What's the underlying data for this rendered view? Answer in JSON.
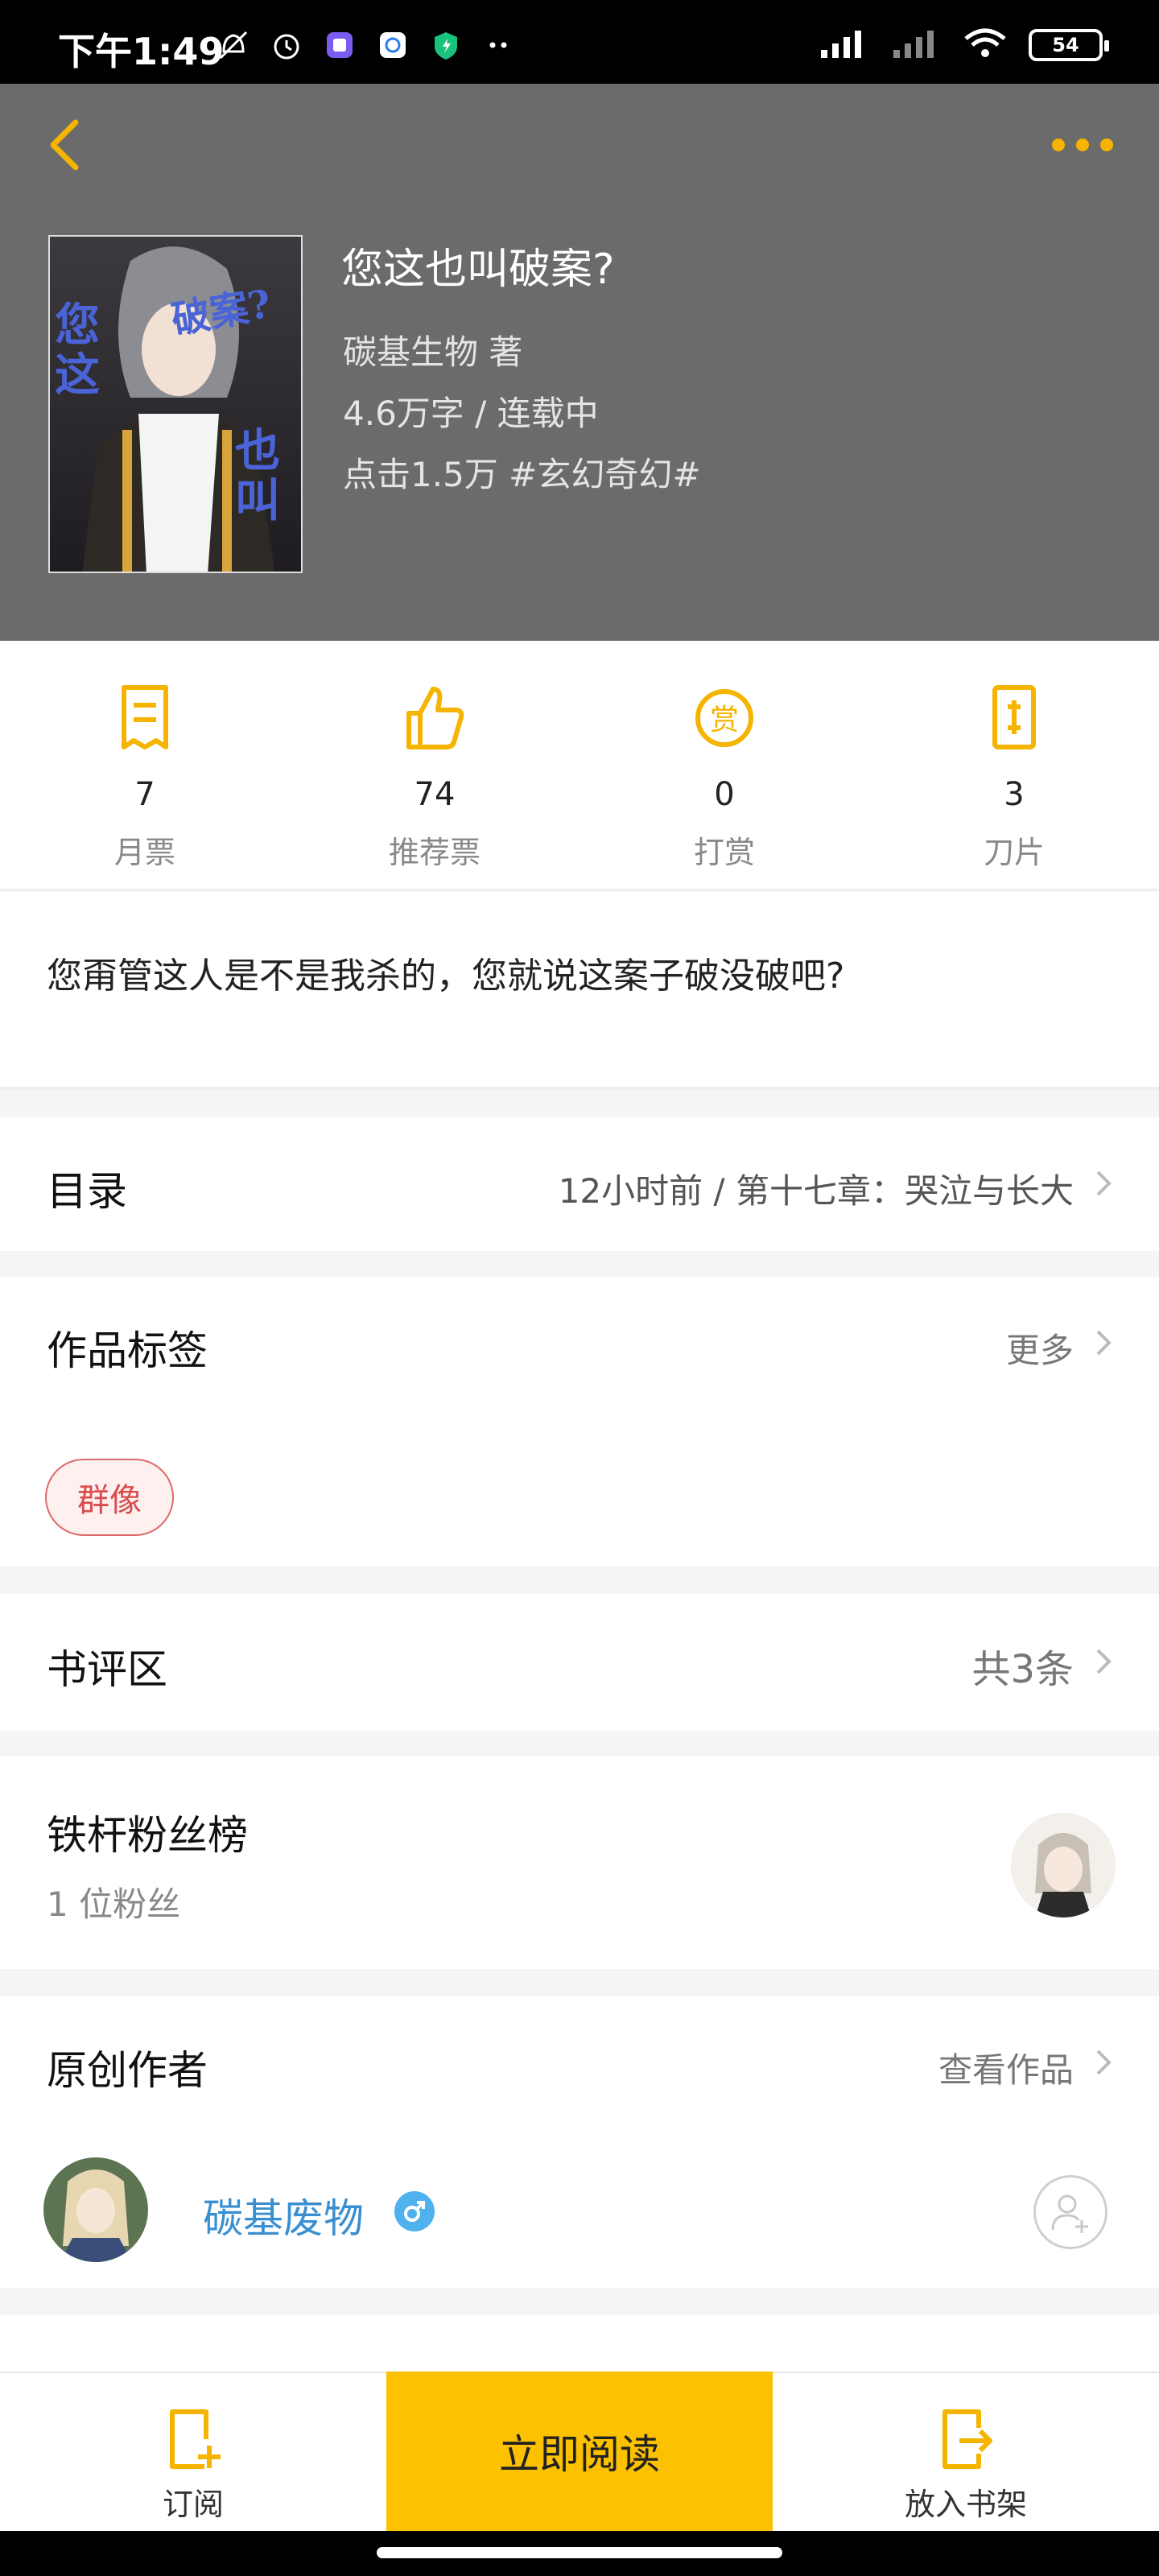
{
  "status_bar": {
    "time": "下午1:49",
    "battery": "54"
  },
  "book": {
    "title": "您这也叫破案?",
    "author": "碳基生物  著",
    "words_status": "4.6万字 / 连载中",
    "clicks_genre": "点击1.5万  #玄幻奇幻#",
    "cover_text": [
      "您这",
      "破案?",
      "也叫"
    ]
  },
  "stats": [
    {
      "value": "7",
      "label": "月票",
      "icon": "ticket-icon"
    },
    {
      "value": "74",
      "label": "推荐票",
      "icon": "thumbs-up-icon"
    },
    {
      "value": "0",
      "label": "打赏",
      "icon": "reward-icon"
    },
    {
      "value": "3",
      "label": "刀片",
      "icon": "blade-icon"
    }
  ],
  "description": "您甭管这人是不是我杀的，您就说这案子破没破吧?",
  "catalog": {
    "title": "目录",
    "latest": "12小时前 / 第十七章：哭泣与长大"
  },
  "tags": {
    "title": "作品标签",
    "more": "更多",
    "items": [
      "群像"
    ]
  },
  "reviews": {
    "title": "书评区",
    "count": "共3条"
  },
  "fans": {
    "title": "铁杆粉丝榜",
    "subtitle": "1 位粉丝"
  },
  "author_section": {
    "title": "原创作者",
    "view_works": "查看作品",
    "name": "碳基废物",
    "gender_icon": "male-icon"
  },
  "bottom_bar": {
    "subscribe": "订阅",
    "read_now": "立即阅读",
    "add_shelf": "放入书架"
  },
  "colors": {
    "accent": "#f5b400",
    "header_bg": "#6a6b6a",
    "read_button": "#fcc100",
    "tag_red": "#d84c4c",
    "author_blue": "#3a8fd0"
  }
}
